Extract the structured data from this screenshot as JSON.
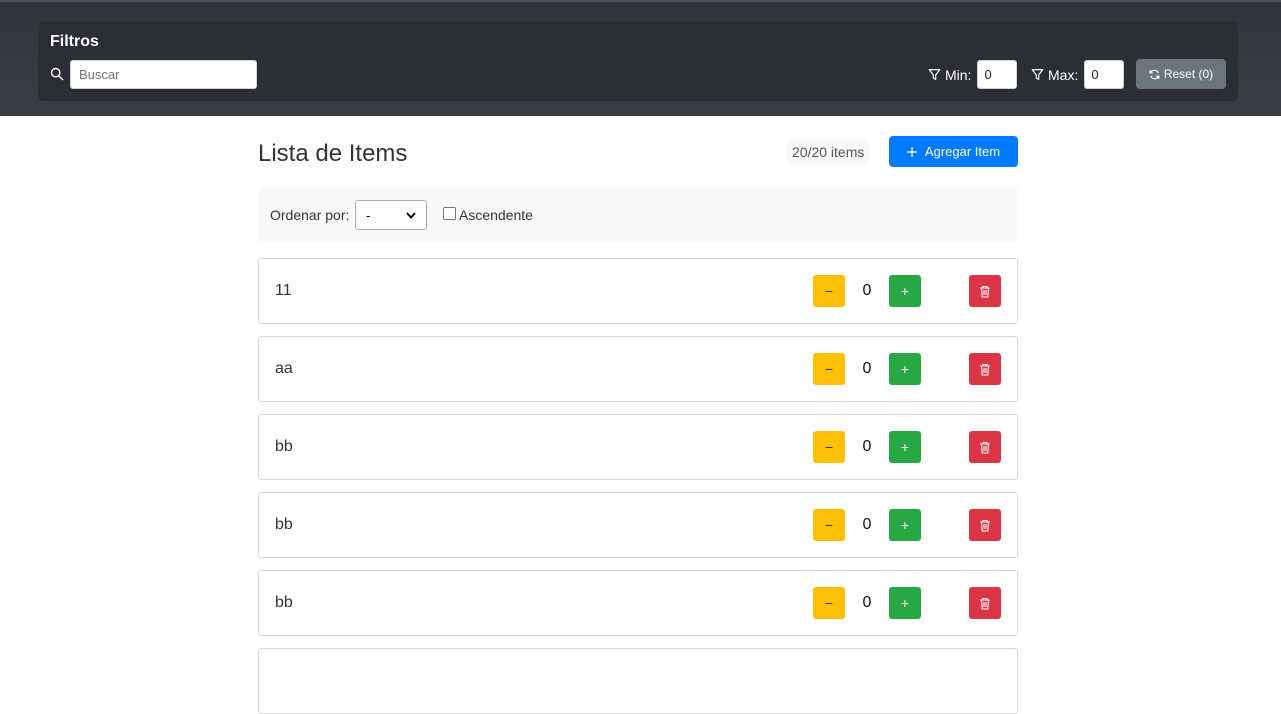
{
  "filters": {
    "title": "Filtros",
    "search_placeholder": "Buscar",
    "min_label": "Min:",
    "min_value": "0",
    "max_label": "Max:",
    "max_value": "0",
    "reset_label": "Reset (0)"
  },
  "list": {
    "title": "Lista de Items",
    "count": "20/20 items",
    "add_label": "Agregar Item",
    "sort_label": "Ordenar por:",
    "sort_selected": "-",
    "ascending_label": "Ascendente",
    "ascending_checked": false,
    "minus_glyph": "−",
    "plus_glyph": "+",
    "items": [
      {
        "name": "11",
        "qty": "0"
      },
      {
        "name": "aa",
        "qty": "0"
      },
      {
        "name": "bb",
        "qty": "0"
      },
      {
        "name": "bb",
        "qty": "0"
      },
      {
        "name": "bb",
        "qty": "0"
      }
    ]
  },
  "colors": {
    "primary": "#007bff",
    "warning": "#ffc107",
    "success": "#28a745",
    "danger": "#dc3545",
    "secondary": "#6c757d",
    "dark": "#2b2e33"
  }
}
